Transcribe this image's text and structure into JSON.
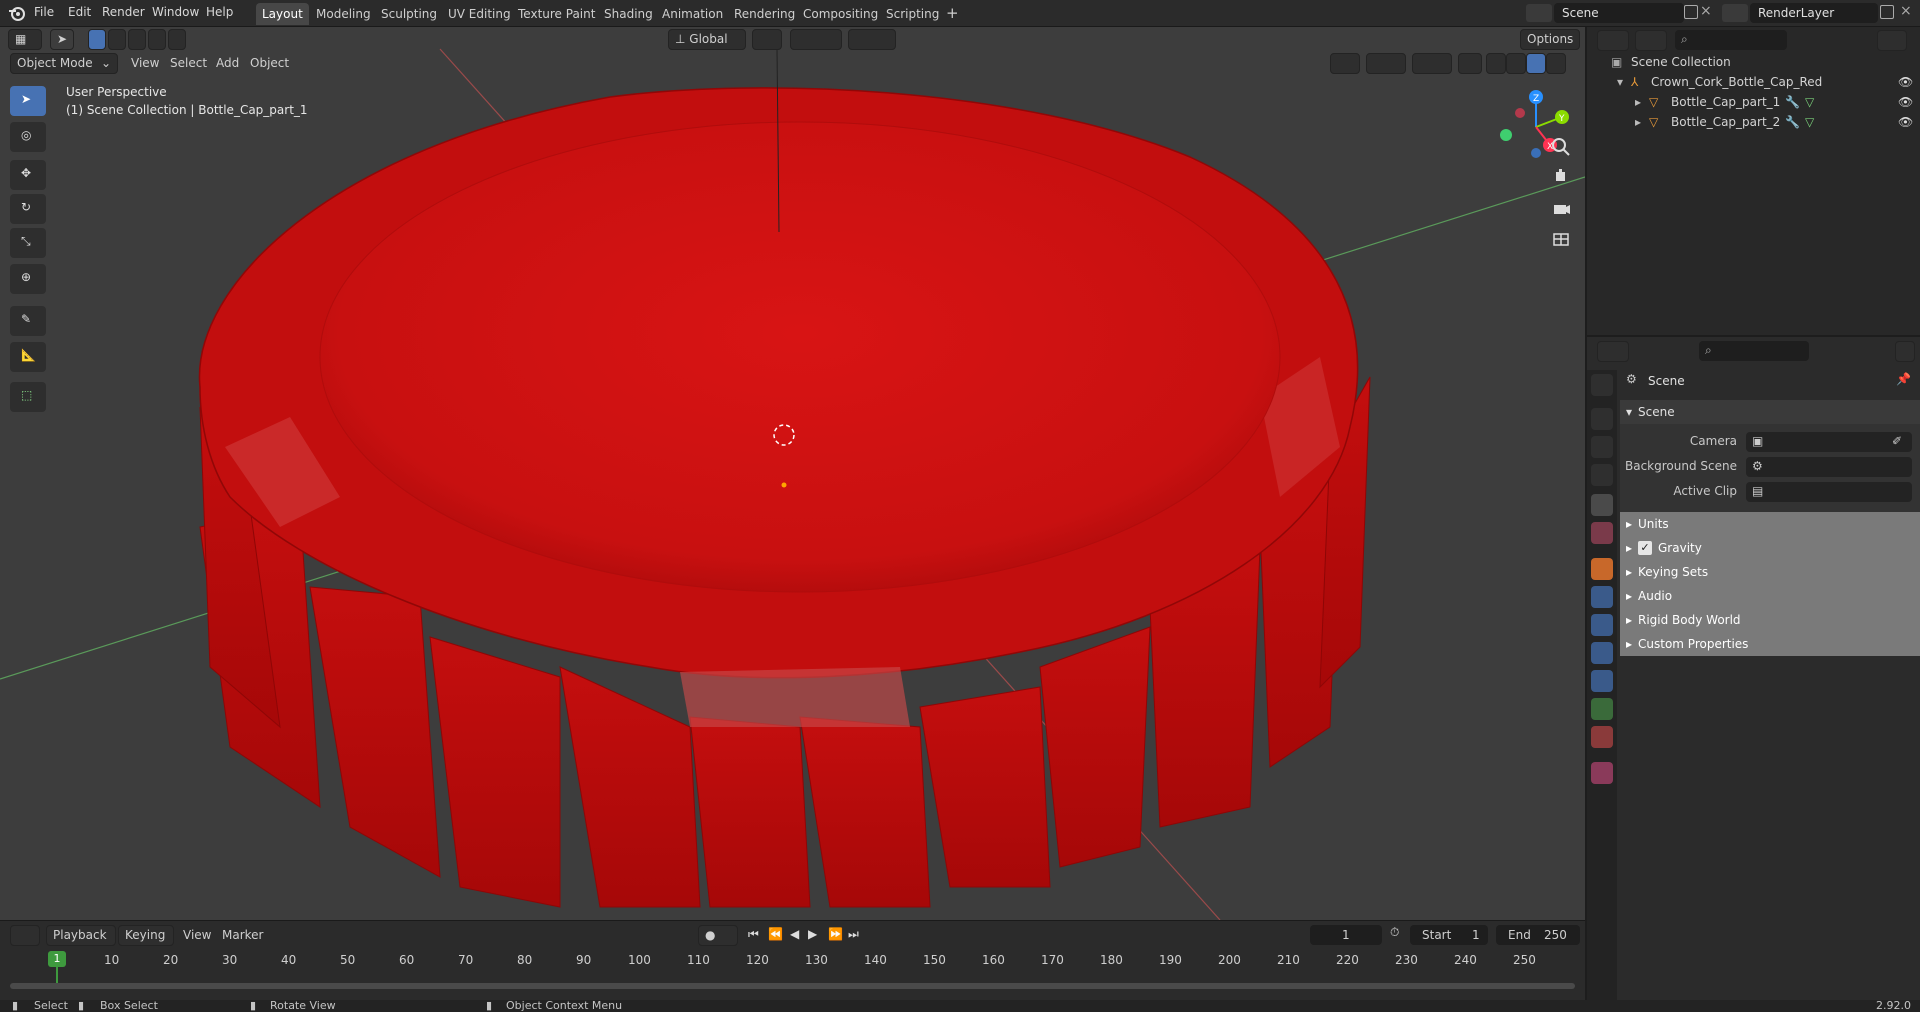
{
  "menu": [
    "File",
    "Edit",
    "Render",
    "Window",
    "Help"
  ],
  "workspaces": [
    "Layout",
    "Modeling",
    "Sculpting",
    "UV Editing",
    "Texture Paint",
    "Shading",
    "Animation",
    "Rendering",
    "Compositing",
    "Scripting"
  ],
  "active_workspace": "Layout",
  "scene_field": "Scene",
  "renderlayer_field": "RenderLayer",
  "viewport": {
    "mode": "Object Mode",
    "menus": [
      "View",
      "Select",
      "Add",
      "Object"
    ],
    "orientation": "Global",
    "options_label": "Options",
    "overlay_title": "User Perspective",
    "overlay_subtitle": "(1) Scene Collection | Bottle_Cap_part_1",
    "gizmo_axes": {
      "x": "X",
      "y": "Y",
      "z": "Z"
    }
  },
  "outliner": {
    "root": "Scene Collection",
    "collection": "Crown_Cork_Bottle_Cap_Red",
    "objects": [
      "Bottle_Cap_part_1",
      "Bottle_Cap_part_2"
    ]
  },
  "properties": {
    "header": "Scene",
    "panel": "Scene",
    "fields": [
      {
        "label": "Camera"
      },
      {
        "label": "Background Scene"
      },
      {
        "label": "Active Clip"
      }
    ],
    "subpanels": [
      "Units",
      "Gravity",
      "Keying Sets",
      "Audio",
      "Rigid Body World",
      "Custom Properties"
    ],
    "gravity_checked": true
  },
  "timeline": {
    "menus": [
      "Playback",
      "Keying",
      "View",
      "Marker"
    ],
    "current_frame": "1",
    "start_label": "Start",
    "start": "1",
    "end_label": "End",
    "end": "250",
    "ticks": [
      "1",
      "10",
      "20",
      "30",
      "40",
      "50",
      "60",
      "70",
      "80",
      "90",
      "100",
      "110",
      "120",
      "130",
      "140",
      "150",
      "160",
      "170",
      "180",
      "190",
      "200",
      "210",
      "220",
      "230",
      "240",
      "250"
    ]
  },
  "status": {
    "select": "Select",
    "box_select": "Box Select",
    "rotate_view": "Rotate View",
    "context_menu": "Object Context Menu",
    "version": "2.92.0"
  },
  "colors": {
    "accent": "#4772b3",
    "object": "#cc1010",
    "frame_marker": "#3e9a3e",
    "axis_x": "#ff3352",
    "axis_y": "#8bdc00",
    "axis_z": "#2890ff"
  }
}
